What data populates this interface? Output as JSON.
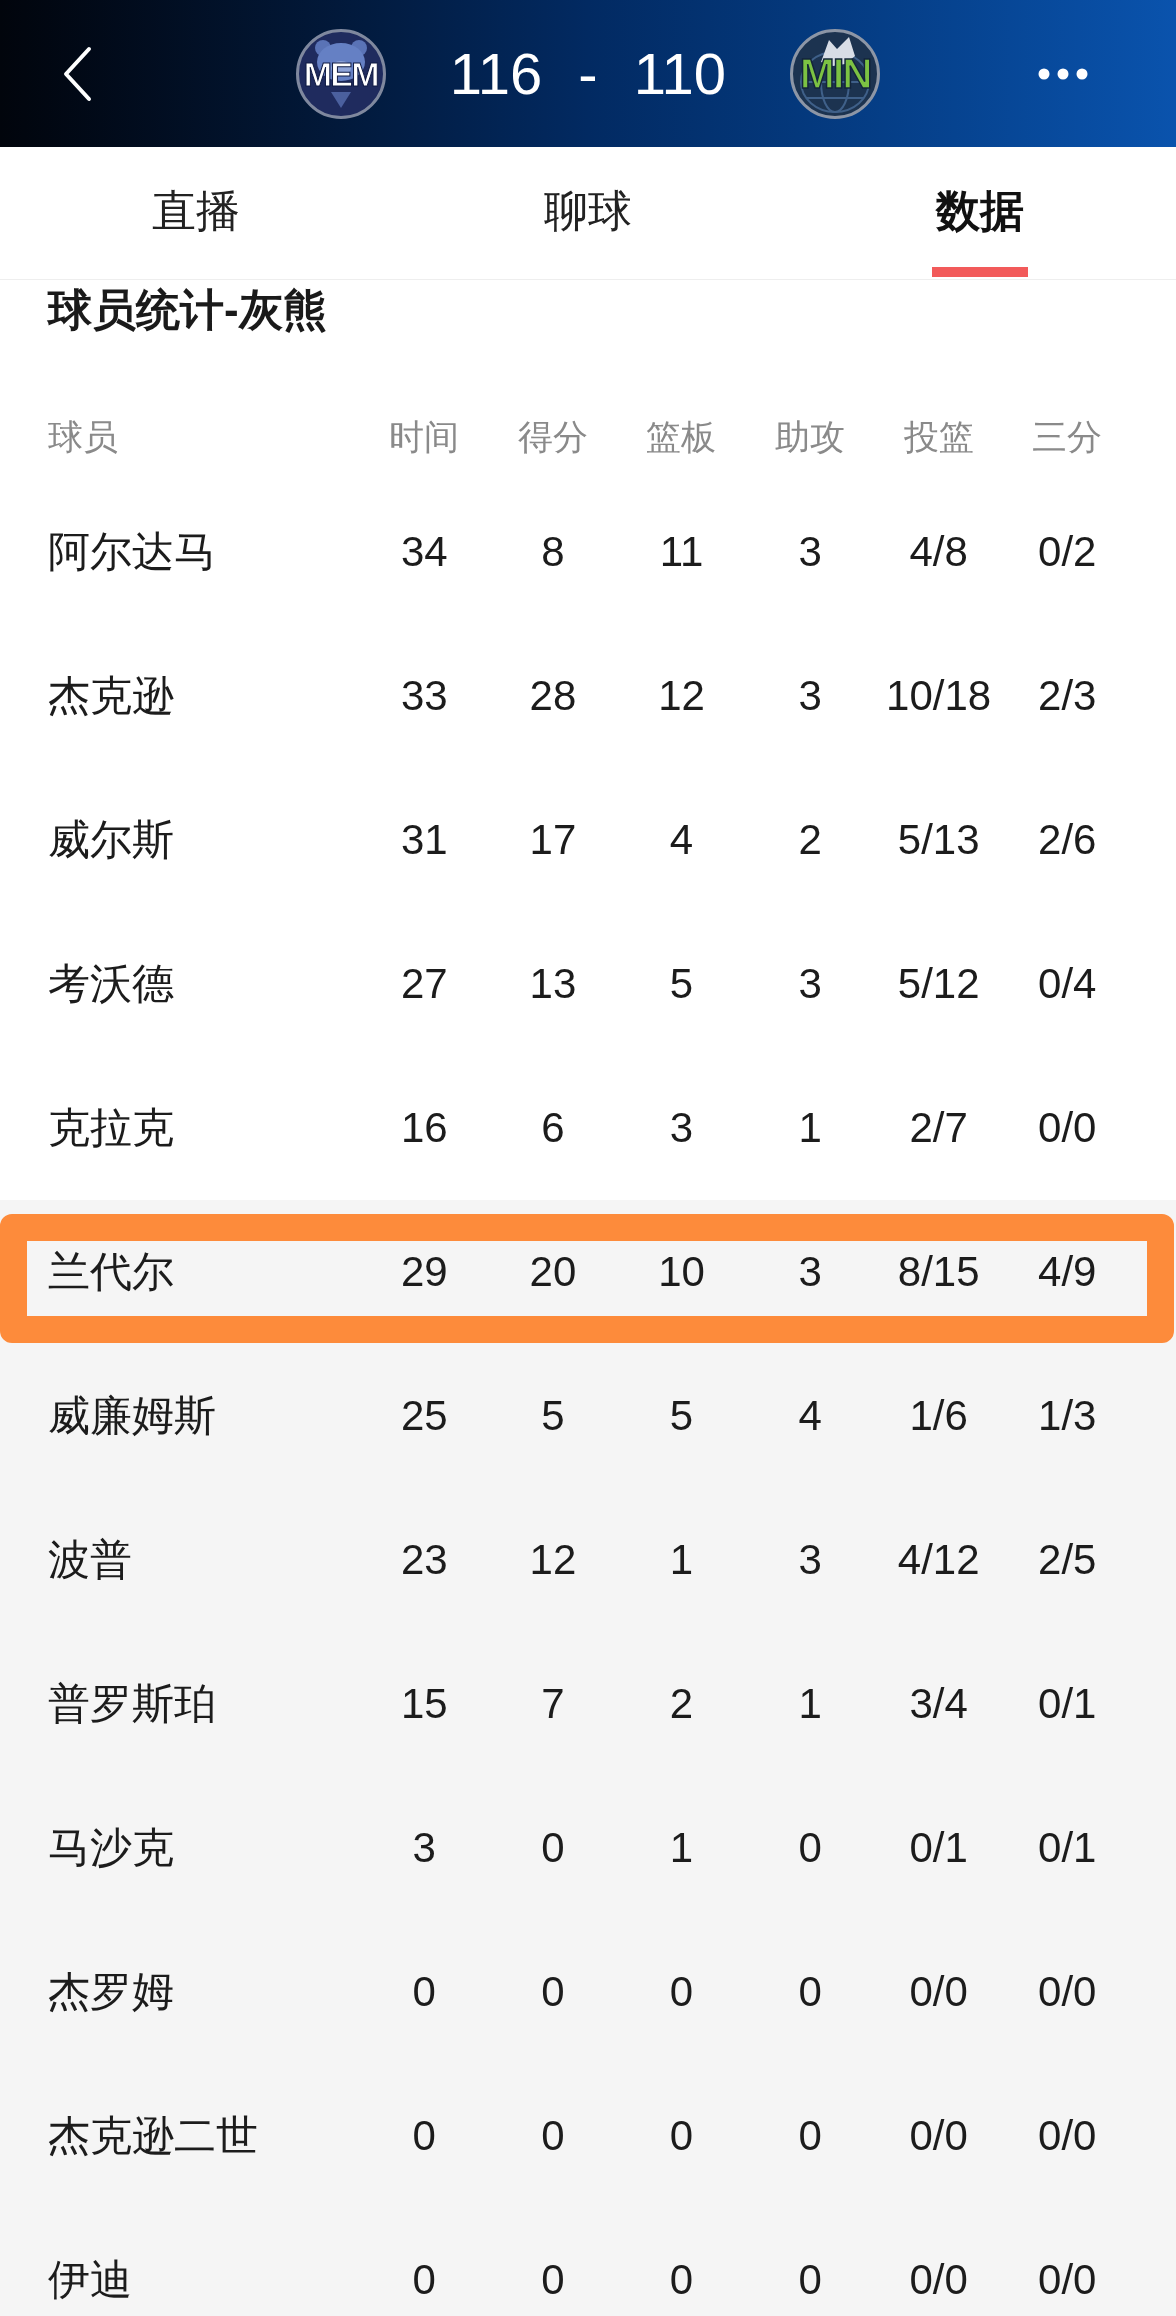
{
  "header": {
    "home_team": {
      "abbr": "MEM"
    },
    "score": {
      "home": "116",
      "separator": "-",
      "away": "110"
    },
    "away_team": {
      "abbr": "MIN"
    }
  },
  "tabs": [
    {
      "label": "直播",
      "selected": false
    },
    {
      "label": "聊球",
      "selected": false
    },
    {
      "label": "数据",
      "selected": true
    }
  ],
  "section_title": "球员统计-灰熊",
  "table": {
    "columns": [
      "球员",
      "时间",
      "得分",
      "篮板",
      "助攻",
      "投篮",
      "三分"
    ],
    "groups": [
      {
        "kind": "starters",
        "rows": [
          {
            "highlighted": false,
            "cells": [
              "阿尔达马",
              "34",
              "8",
              "11",
              "3",
              "4/8",
              "0/2"
            ]
          },
          {
            "highlighted": false,
            "cells": [
              "杰克逊",
              "33",
              "28",
              "12",
              "3",
              "10/18",
              "2/3"
            ]
          },
          {
            "highlighted": false,
            "cells": [
              "威尔斯",
              "31",
              "17",
              "4",
              "2",
              "5/13",
              "2/6"
            ]
          },
          {
            "highlighted": false,
            "cells": [
              "考沃德",
              "27",
              "13",
              "5",
              "3",
              "5/12",
              "0/4"
            ]
          },
          {
            "highlighted": false,
            "cells": [
              "克拉克",
              "16",
              "6",
              "3",
              "1",
              "2/7",
              "0/0"
            ]
          }
        ]
      },
      {
        "kind": "bench",
        "rows": [
          {
            "highlighted": true,
            "cells": [
              "兰代尔",
              "29",
              "20",
              "10",
              "3",
              "8/15",
              "4/9"
            ]
          },
          {
            "highlighted": false,
            "cells": [
              "威廉姆斯",
              "25",
              "5",
              "5",
              "4",
              "1/6",
              "1/3"
            ]
          },
          {
            "highlighted": false,
            "cells": [
              "波普",
              "23",
              "12",
              "1",
              "3",
              "4/12",
              "2/5"
            ]
          },
          {
            "highlighted": false,
            "cells": [
              "普罗斯珀",
              "15",
              "7",
              "2",
              "1",
              "3/4",
              "0/1"
            ]
          },
          {
            "highlighted": false,
            "cells": [
              "马沙克",
              "3",
              "0",
              "1",
              "0",
              "0/1",
              "0/1"
            ]
          },
          {
            "highlighted": false,
            "cells": [
              "杰罗姆",
              "0",
              "0",
              "0",
              "0",
              "0/0",
              "0/0"
            ]
          },
          {
            "highlighted": false,
            "cells": [
              "杰克逊二世",
              "0",
              "0",
              "0",
              "0",
              "0/0",
              "0/0"
            ]
          },
          {
            "highlighted": false,
            "cells": [
              "伊迪",
              "0",
              "0",
              "0",
              "0",
              "0/0",
              "0/0"
            ]
          }
        ]
      }
    ]
  }
}
